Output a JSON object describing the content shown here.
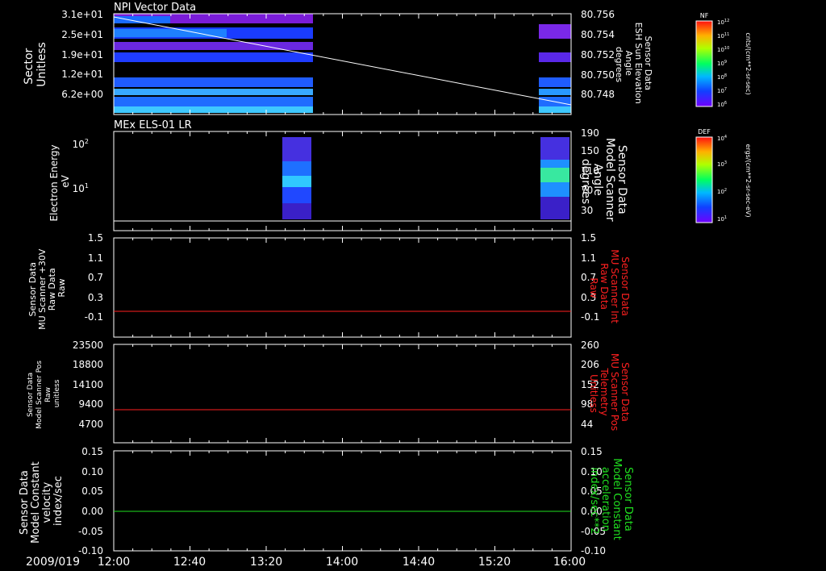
{
  "chart_data": [
    {
      "type": "heatmap",
      "title": "NPI Vector Data",
      "ylabel": [
        "Sector",
        "Unitless"
      ],
      "yticks": [
        "3.1e+01",
        "2.5e+01",
        "1.9e+01",
        "1.2e+01",
        "6.2e+00"
      ],
      "y2label": [
        "Sensor Data",
        "ESH Sun Elevation",
        "Angle",
        "degrees"
      ],
      "y2ticks": [
        "80.756",
        "80.754",
        "80.752",
        "80.750",
        "80.748"
      ],
      "data_time_ranges": [
        [
          "12:00",
          "13:35"
        ],
        [
          "15:50",
          "16:00"
        ]
      ],
      "overlay_line": {
        "series": "ESH Sun Elevation Angle",
        "from": 80.7563,
        "to": 80.7466
      },
      "colorbar": {
        "label": "NF",
        "units": "cnts/(cm**2-sr-sec)",
        "exponents": [
          "12",
          "11",
          "10",
          "9",
          "8",
          "7",
          "6"
        ]
      }
    },
    {
      "type": "heatmap",
      "title": "MEx ELS-01 LR",
      "ylabel": [
        "Electron Energy",
        "eV"
      ],
      "yticks": [
        "10",
        "10"
      ],
      "yexps": [
        "2",
        "1"
      ],
      "y2label": [
        "Sensor Data",
        "Model Scanner",
        "Angle",
        "degrees"
      ],
      "y2ticks": [
        "190",
        "150",
        "110",
        "70",
        "30"
      ],
      "data_time_ranges": [
        [
          "13:25",
          "13:35"
        ],
        [
          "15:50",
          "16:00"
        ]
      ],
      "overlay_line": {
        "series": "Model Scanner Angle",
        "value": 10
      },
      "colorbar": {
        "label": "DEF",
        "units": "ergs/(cm**2-sr-sec-eV)",
        "exponents": [
          "4",
          "3",
          "2",
          "1"
        ]
      }
    },
    {
      "type": "line",
      "ylabel": [
        "Sensor Data",
        "MU Scanner +30V",
        "Raw Data",
        "Raw"
      ],
      "yticks": [
        "1.5",
        "1.1",
        "0.7",
        "0.3",
        "-0.1"
      ],
      "ylim": [
        -0.3,
        1.5
      ],
      "y2label": [
        "Sensor Data",
        "MU Scanner Int",
        "Raw Data",
        "Raw"
      ],
      "y2ticks": [
        "1.5",
        "1.1",
        "0.7",
        "0.3",
        "-0.1"
      ],
      "series": [
        {
          "name": "MU Scanner Int Raw Data",
          "color": "#ff2020",
          "value": 0.0
        }
      ]
    },
    {
      "type": "line",
      "ylabel": [
        "Sensor Data",
        "Model Scanner Pos",
        "Raw",
        "unitless"
      ],
      "yticks": [
        "23500",
        "18800",
        "14100",
        "9400",
        "4700"
      ],
      "ylim": [
        0,
        23500
      ],
      "y2label": [
        "Sensor Data",
        "MU Scanner Pos",
        "Telemetry",
        "Unitless"
      ],
      "y2ticks": [
        "260",
        "206",
        "152",
        "98",
        "44"
      ],
      "y2lim": [
        -10,
        260
      ],
      "series": [
        {
          "name": "MU Scanner Pos Telemetry",
          "color": "#ff2020",
          "value": 80
        }
      ]
    },
    {
      "type": "line",
      "ylabel": [
        "Sensor Data",
        "Model Constant",
        "velocity",
        "index/sec"
      ],
      "yticks": [
        "0.15",
        "0.10",
        "0.05",
        "0.00",
        "-0.05",
        "-0.10"
      ],
      "ylim": [
        -0.1,
        0.15
      ],
      "y2label": [
        "Sensor Data",
        "Model Constant",
        "acceleration",
        "index/sec**2"
      ],
      "y2ticks": [
        "0.15",
        "0.10",
        "0.05",
        "0.00",
        "-0.05",
        "-0.10"
      ],
      "series": [
        {
          "name": "Model Constant acceleration",
          "color": "#20e020",
          "value": 0.0
        }
      ]
    }
  ],
  "time_axis": {
    "date": "2009/019",
    "ticks": [
      "12:00",
      "12:40",
      "13:20",
      "14:00",
      "14:40",
      "15:20",
      "16:00"
    ]
  },
  "colors": {
    "axis": "#ffffff",
    "red": "#ff2020",
    "green": "#20e020",
    "bg": "#000000"
  }
}
